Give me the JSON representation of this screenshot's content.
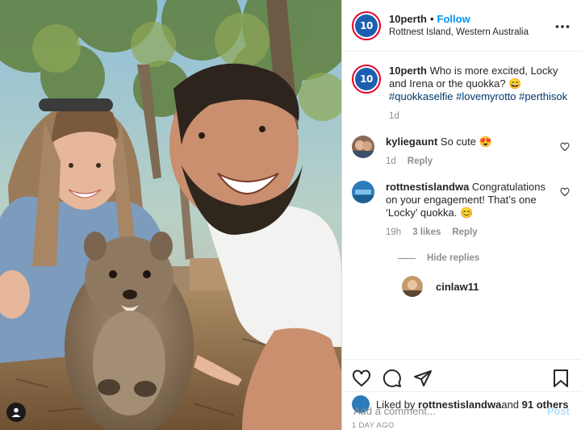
{
  "header": {
    "username": "10perth",
    "follow_label": "Follow",
    "dot": "•",
    "location": "Rottnest Island, Western Australia",
    "more": "•••",
    "avatar_text": "10"
  },
  "caption": {
    "username": "10perth",
    "text": "Who is more excited, Locky and Irena or the quokka? 😄",
    "hashtags": "#quokkaselfie #lovemyrotto #perthisok",
    "age": "1d"
  },
  "comments": [
    {
      "username": "kyliegaunt",
      "text": "So cute 😍",
      "age": "1d",
      "reply_label": "Reply"
    },
    {
      "username": "rottnestislandwa",
      "text": "Congratulations on your engagement! That’s one ‘Locky’ quokka. 😊",
      "age": "19h",
      "likes": "3 likes",
      "reply_label": "Reply"
    }
  ],
  "hide_replies_label": "Hide replies",
  "reply": {
    "username": "cinlaw11"
  },
  "likes": {
    "prefix": "Liked by ",
    "user": "rottnestislandwa",
    "middle": " and ",
    "others": "91 others"
  },
  "timestamp": "1 DAY AGO",
  "add_comment": {
    "placeholder": "Add a comment...",
    "post_label": "Post"
  },
  "colors": {
    "follow": "#0095f6",
    "hashtag": "#00376b",
    "brand_ring": "#e4002b",
    "brand_blue": "#1c5fb0"
  },
  "icons": [
    "heart-icon",
    "comment-icon",
    "share-icon",
    "bookmark-icon",
    "more-icon",
    "user-tag-icon"
  ]
}
